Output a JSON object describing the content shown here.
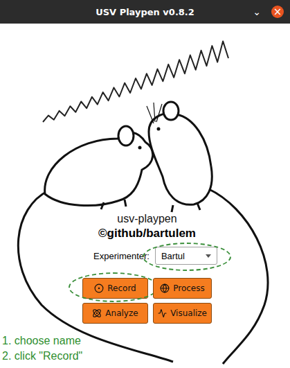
{
  "window": {
    "title": "USV Playpen v0.8.2",
    "controls": [
      {
        "label": "⌄",
        "kind": "plain"
      },
      {
        "label": "×",
        "kind": "circle"
      }
    ]
  },
  "app": {
    "name": "usv-playpen",
    "credit": "©github/bartulem"
  },
  "experimenter": {
    "label": "Experimenter:",
    "value": "Bartul",
    "highlighted": true
  },
  "buttons": [
    {
      "label": "Record",
      "highlighted": true
    },
    {
      "label": "Process",
      "highlighted": false
    },
    {
      "label": "Analyze",
      "highlighted": false
    },
    {
      "label": "Visualize",
      "highlighted": false
    }
  ],
  "instructions": [
    "1. choose name",
    "2. click \"Record\""
  ]
}
